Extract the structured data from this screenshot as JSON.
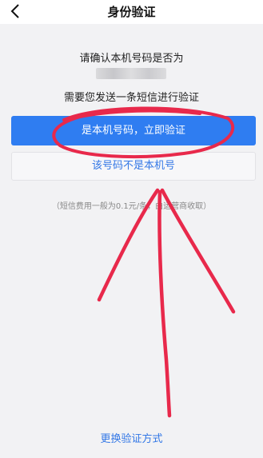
{
  "header": {
    "title": "身份验证",
    "back_icon": "chevron-left-icon"
  },
  "main": {
    "prompt": "请确认本机号码是否为",
    "phone_number_masked": "",
    "info": "需要您发送一条短信进行验证",
    "primary_button_label": "是本机号码，立即验证",
    "secondary_button_label": "该号码不是本机号",
    "fee_note": "（短信费用一般为0.1元/条，由运营商收取）"
  },
  "footer": {
    "switch_method_label": "更换验证方式"
  },
  "colors": {
    "primary": "#2f7df1",
    "link": "#3478e6",
    "annotation": "#e8294b"
  }
}
